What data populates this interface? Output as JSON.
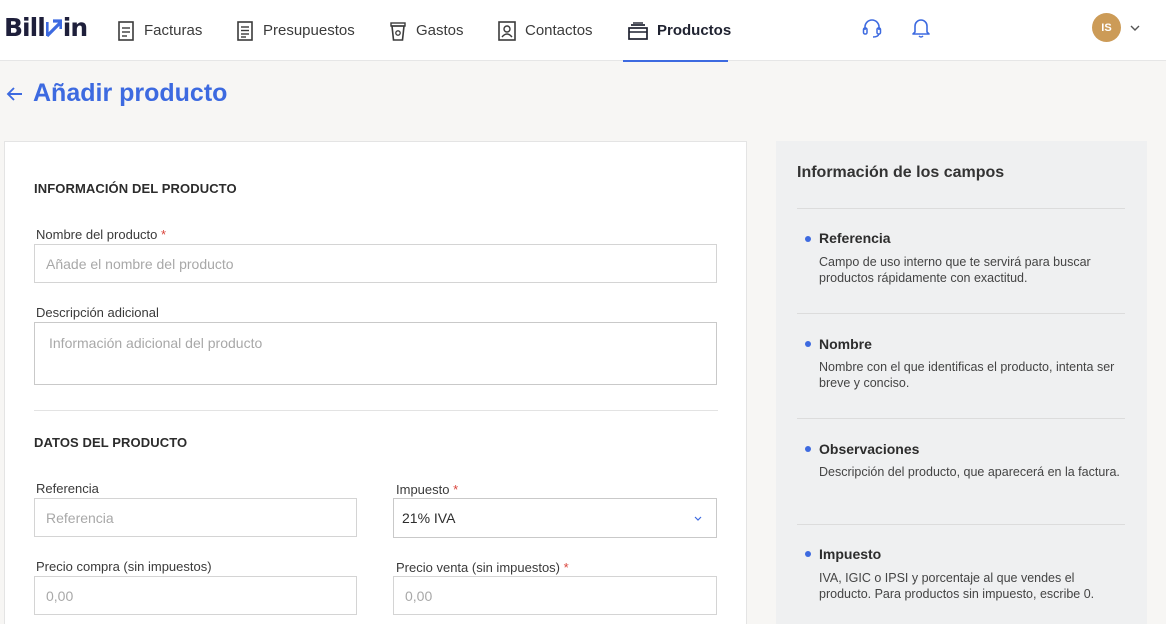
{
  "brand": {
    "logo_text_left": "Bill",
    "logo_text_right": "in",
    "accent_color": "#3d6ae0"
  },
  "nav": {
    "items": [
      {
        "label": "Facturas",
        "icon": "invoice-icon"
      },
      {
        "label": "Presupuestos",
        "icon": "quote-icon"
      },
      {
        "label": "Gastos",
        "icon": "expense-cup-icon"
      },
      {
        "label": "Contactos",
        "icon": "contact-card-icon"
      },
      {
        "label": "Productos",
        "icon": "product-box-icon",
        "active": true
      }
    ]
  },
  "user": {
    "initials": "IS"
  },
  "page": {
    "title": "Añadir producto"
  },
  "form": {
    "section_product_info": "INFORMACIÓN DEL PRODUCTO",
    "name_label": "Nombre del producto",
    "name_placeholder": "Añade el nombre del producto",
    "description_label": "Descripción adicional",
    "description_placeholder": "Información adicional del producto",
    "section_product_data": "DATOS DEL PRODUCTO",
    "reference_label": "Referencia",
    "reference_placeholder": "Referencia",
    "tax_label": "Impuesto",
    "tax_value": "21% IVA",
    "purchase_price_label": "Precio compra (sin impuestos)",
    "purchase_price_placeholder": "0,00",
    "sale_price_label": "Precio venta (sin impuestos)",
    "sale_price_placeholder": "0,00",
    "required_marker": "*"
  },
  "info_panel": {
    "title": "Información de los campos",
    "items": [
      {
        "title": "Referencia",
        "description": "Campo de uso interno que te servirá para buscar productos rápidamente con exactitud."
      },
      {
        "title": "Nombre",
        "description": "Nombre con el que identificas el producto, intenta ser breve y conciso."
      },
      {
        "title": "Observaciones",
        "description": "Descripción del producto, que aparecerá en la factura."
      },
      {
        "title": "Impuesto",
        "description": "IVA, IGIC o IPSI y porcentaje al que vendes el producto. Para productos sin impuesto, escribe 0."
      }
    ]
  }
}
